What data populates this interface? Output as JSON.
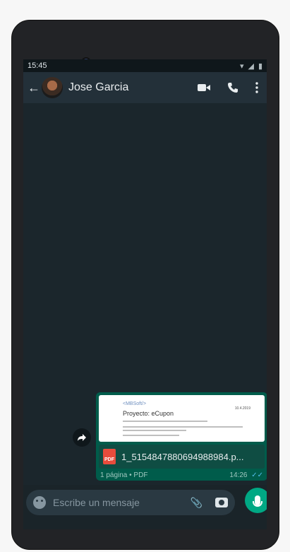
{
  "status_bar": {
    "time": "15:45"
  },
  "header": {
    "contact_name": "Jose Garcia",
    "icons": [
      "back-arrow-icon",
      "video-call-icon",
      "voice-call-icon",
      "menu-icon"
    ]
  },
  "message": {
    "preview": {
      "logo_text": "<MBSoft/>",
      "date": "10.4.2019",
      "project_title": "Proyecto: eCupon"
    },
    "file_badge": "PDF",
    "filename": "1_5154847880694988984.p...",
    "pages_info": "1 página • PDF",
    "time": "14:26",
    "ticks": "✓✓"
  },
  "composer": {
    "placeholder": "Escribe un mensaje"
  },
  "colors": {
    "accent": "#00a884",
    "bubble": "#005c4b",
    "header": "#233039"
  }
}
